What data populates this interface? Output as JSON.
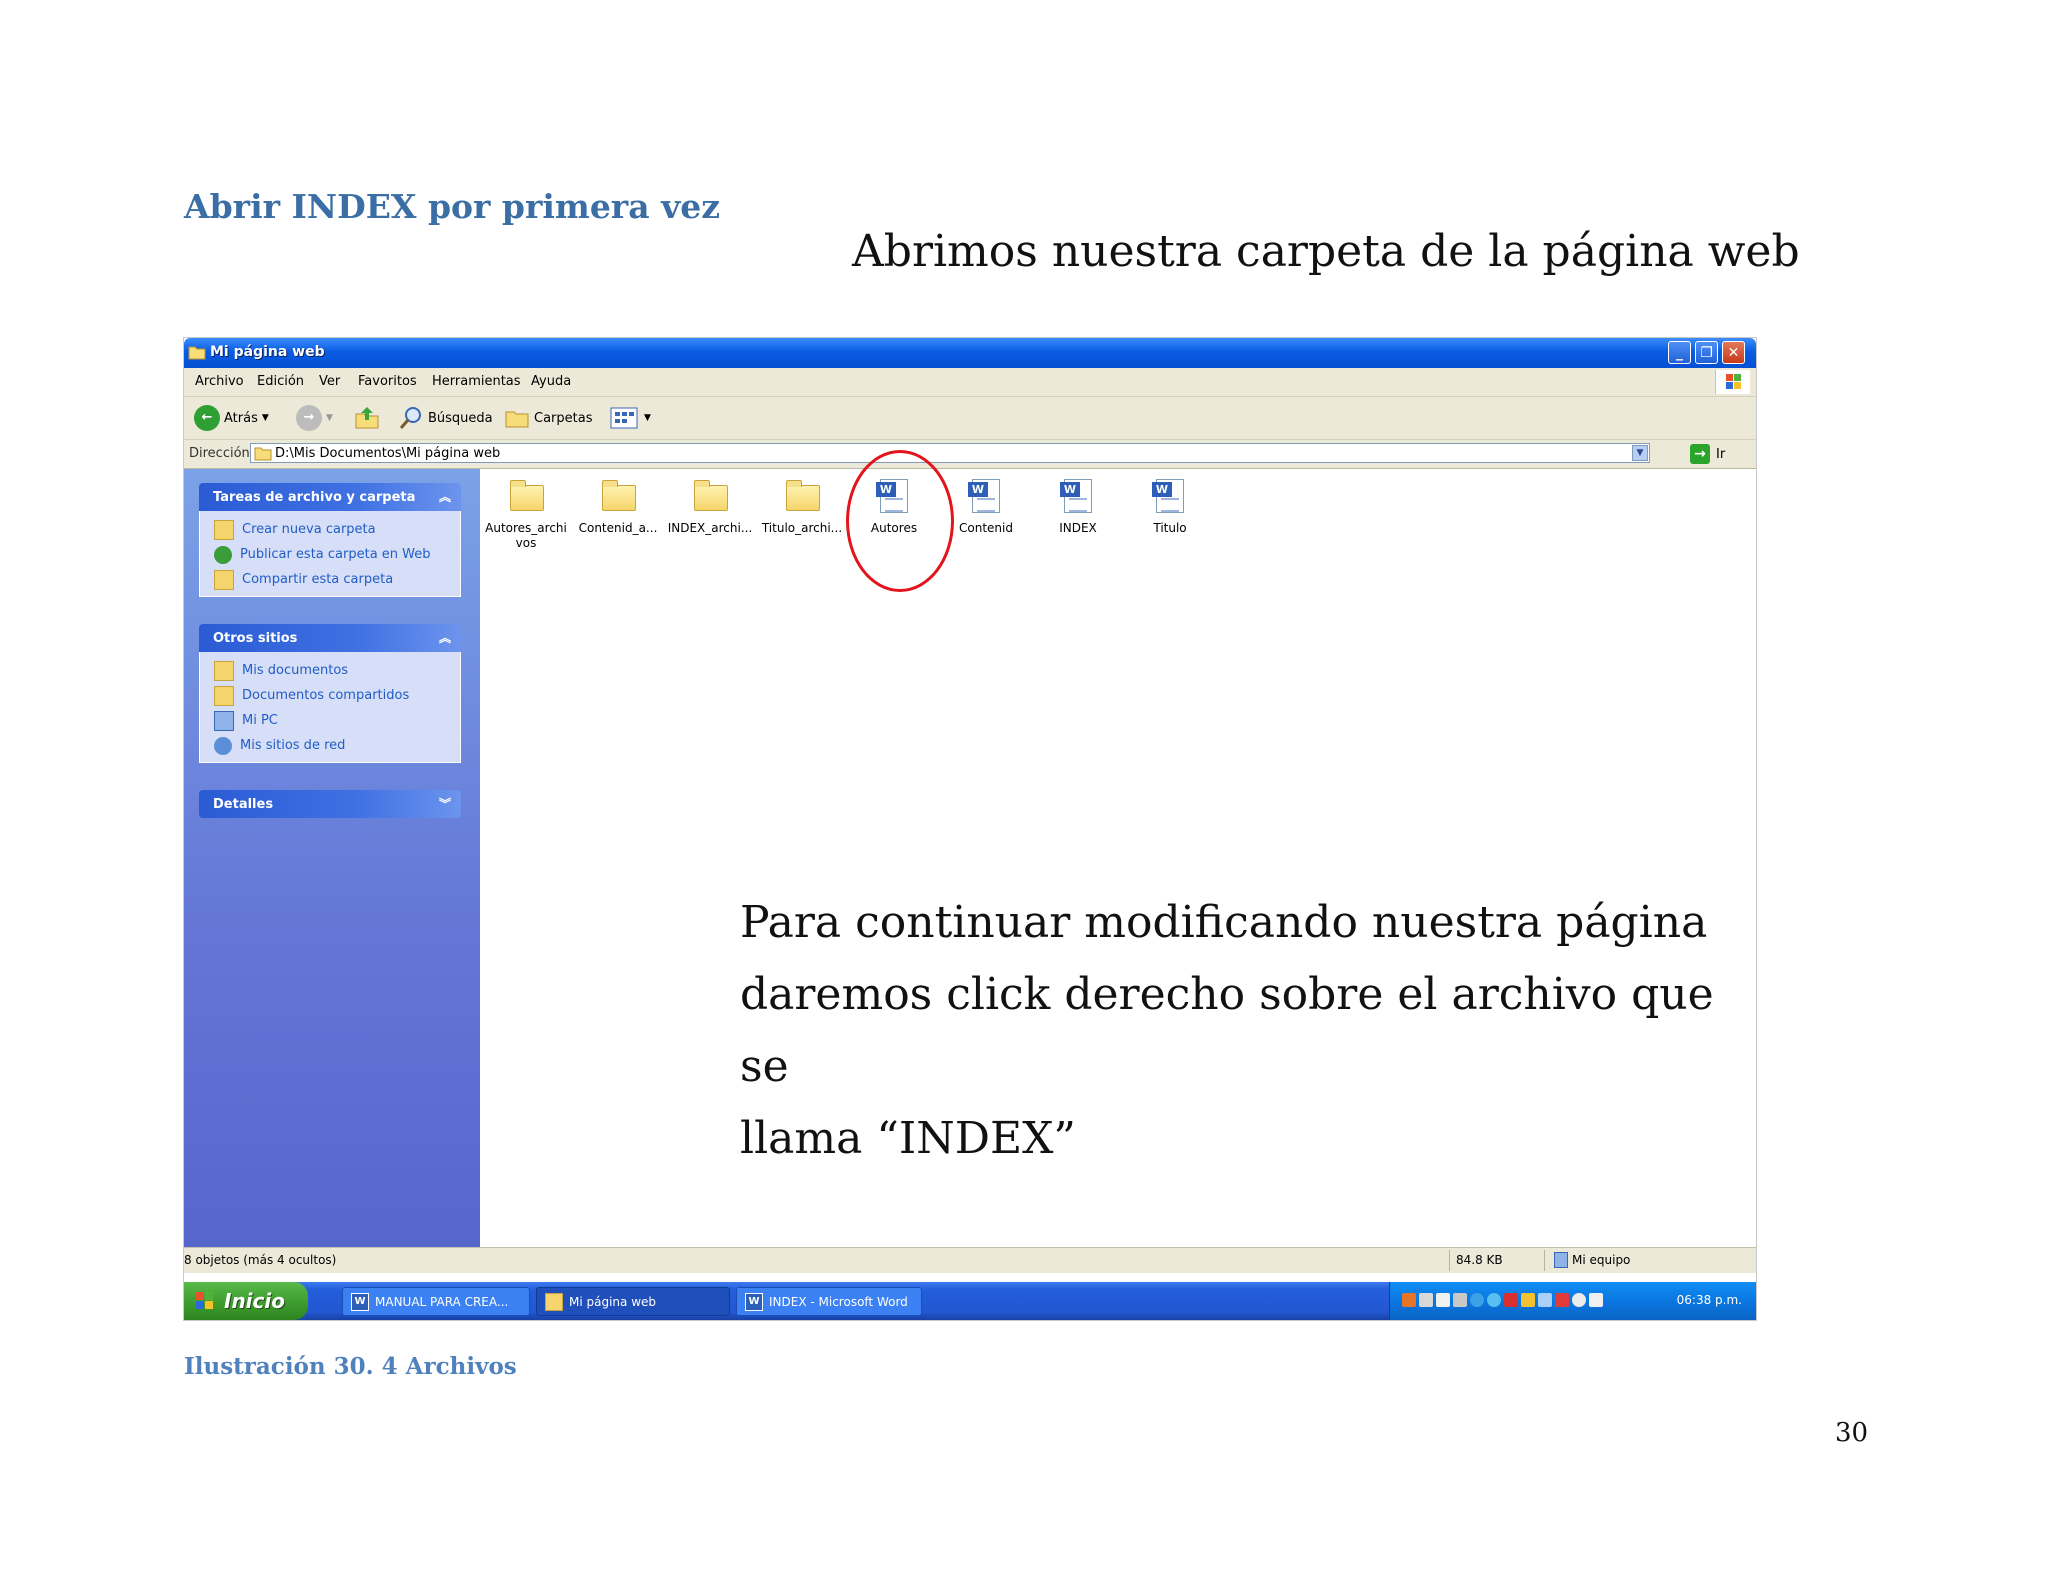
{
  "doc": {
    "heading": "Abrir INDEX por primera vez",
    "intro": "Abrimos nuestra carpeta de la página web",
    "overlay_lines": [
      "Para continuar modificando nuestra página",
      "daremos click derecho sobre el archivo que se",
      "llama “INDEX”"
    ],
    "caption": "Ilustración 30. 4 Archivos",
    "page_number": "30"
  },
  "window": {
    "title": "Mi página web",
    "menu": [
      "Archivo",
      "Edición",
      "Ver",
      "Favoritos",
      "Herramientas",
      "Ayuda"
    ],
    "toolbar": {
      "back": "Atrás",
      "search": "Búsqueda",
      "folders": "Carpetas"
    },
    "address": {
      "label": "Dirección",
      "path": "D:\\Mis Documentos\\Mi página web",
      "go": "Ir"
    }
  },
  "sidebar": {
    "tasks": {
      "title": "Tareas de archivo y carpeta",
      "items": [
        "Crear nueva carpeta",
        "Publicar esta carpeta en Web",
        "Compartir esta carpeta"
      ]
    },
    "other": {
      "title": "Otros sitios",
      "items": [
        "Mis documentos",
        "Documentos compartidos",
        "Mi PC",
        "Mis sitios de red"
      ]
    },
    "details": {
      "title": "Detalles"
    }
  },
  "files": [
    {
      "name": "Autores_archi vos",
      "type": "folder"
    },
    {
      "name": "Contenid_a...",
      "type": "folder"
    },
    {
      "name": "INDEX_archi...",
      "type": "folder"
    },
    {
      "name": "Titulo_archi...",
      "type": "folder"
    },
    {
      "name": "Autores",
      "type": "word"
    },
    {
      "name": "Contenid",
      "type": "word"
    },
    {
      "name": "INDEX",
      "type": "word"
    },
    {
      "name": "Titulo",
      "type": "word"
    }
  ],
  "status": {
    "objects": "8 objetos (más 4 ocultos)",
    "size": "84.8 KB",
    "location": "Mi equipo"
  },
  "taskbar": {
    "start": "Inicio",
    "tasks": [
      "MANUAL PARA CREA...",
      "Mi página web",
      "INDEX - Microsoft Word"
    ],
    "clock": "06:38 p.m."
  }
}
